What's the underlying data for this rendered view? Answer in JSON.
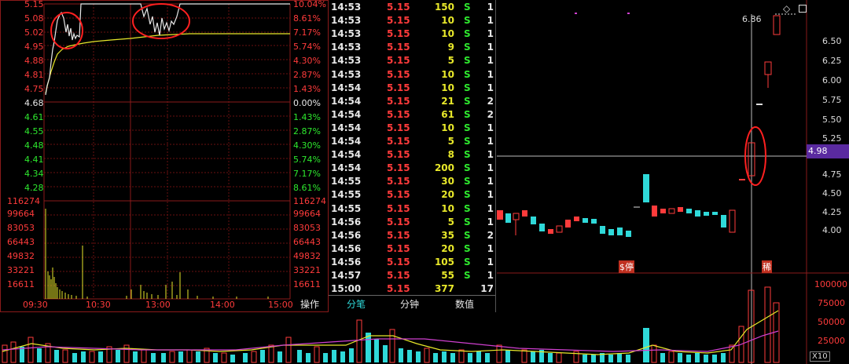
{
  "intraday": {
    "price_labels_left": [
      "5.15",
      "5.08",
      "5.02",
      "4.95",
      "4.88",
      "4.81",
      "4.75",
      "4.68",
      "4.61",
      "4.55",
      "4.48",
      "4.41",
      "4.34",
      "4.28"
    ],
    "pct_labels_right": [
      "10.04%",
      "8.61%",
      "7.17%",
      "5.74%",
      "4.30%",
      "2.87%",
      "1.43%",
      "0.00%",
      "1.43%",
      "2.87%",
      "4.30%",
      "5.74%",
      "7.17%",
      "8.61%"
    ],
    "volume_labels": [
      "116274",
      "99664",
      "83053",
      "66443",
      "49832",
      "33221",
      "16611"
    ],
    "time_labels": [
      "09:30",
      "10:30",
      "13:00",
      "14:00",
      "15:00"
    ]
  },
  "ticks": {
    "rows": [
      {
        "time": "14:53",
        "price": "5.15",
        "vol": "150",
        "side": "S",
        "n": "1"
      },
      {
        "time": "14:53",
        "price": "5.15",
        "vol": "10",
        "side": "S",
        "n": "1"
      },
      {
        "time": "14:53",
        "price": "5.15",
        "vol": "10",
        "side": "S",
        "n": "1"
      },
      {
        "time": "14:53",
        "price": "5.15",
        "vol": "9",
        "side": "S",
        "n": "1"
      },
      {
        "time": "14:53",
        "price": "5.15",
        "vol": "5",
        "side": "S",
        "n": "1"
      },
      {
        "time": "14:53",
        "price": "5.15",
        "vol": "10",
        "side": "S",
        "n": "1"
      },
      {
        "time": "14:54",
        "price": "5.15",
        "vol": "10",
        "side": "S",
        "n": "1"
      },
      {
        "time": "14:54",
        "price": "5.15",
        "vol": "21",
        "side": "S",
        "n": "2"
      },
      {
        "time": "14:54",
        "price": "5.15",
        "vol": "61",
        "side": "S",
        "n": "2"
      },
      {
        "time": "14:54",
        "price": "5.15",
        "vol": "10",
        "side": "S",
        "n": "1"
      },
      {
        "time": "14:54",
        "price": "5.15",
        "vol": "5",
        "side": "S",
        "n": "1"
      },
      {
        "time": "14:54",
        "price": "5.15",
        "vol": "8",
        "side": "S",
        "n": "1"
      },
      {
        "time": "14:54",
        "price": "5.15",
        "vol": "200",
        "side": "S",
        "n": "1"
      },
      {
        "time": "14:55",
        "price": "5.15",
        "vol": "30",
        "side": "S",
        "n": "1"
      },
      {
        "time": "14:55",
        "price": "5.15",
        "vol": "20",
        "side": "S",
        "n": "1"
      },
      {
        "time": "14:55",
        "price": "5.15",
        "vol": "10",
        "side": "S",
        "n": "1"
      },
      {
        "time": "14:56",
        "price": "5.15",
        "vol": "5",
        "side": "S",
        "n": "1"
      },
      {
        "time": "14:56",
        "price": "5.15",
        "vol": "35",
        "side": "S",
        "n": "2"
      },
      {
        "time": "14:56",
        "price": "5.15",
        "vol": "20",
        "side": "S",
        "n": "1"
      },
      {
        "time": "14:56",
        "price": "5.15",
        "vol": "105",
        "side": "S",
        "n": "1"
      },
      {
        "time": "14:57",
        "price": "5.15",
        "vol": "55",
        "side": "S",
        "n": "1"
      },
      {
        "time": "15:00",
        "price": "5.15",
        "vol": "377",
        "side": "",
        "n": "17"
      }
    ]
  },
  "tabs": {
    "ops": "操作",
    "fenbi": "分笔",
    "fenzhong": "分钟",
    "shuzhi": "数值"
  },
  "kline": {
    "price_axis": [
      "6.50",
      "6.25",
      "6.00",
      "5.75",
      "5.50",
      "5.25",
      "4.75",
      "4.50",
      "4.25",
      "4.00"
    ],
    "current_price": "4.98",
    "peak_label": "6.86",
    "volume_axis": [
      "100000",
      "75000",
      "50000",
      "25000"
    ],
    "volume_unit": "X10",
    "zt_marker": "$停",
    "zt_marker2": "稀",
    "colors": {
      "up": "#ff3b3b",
      "down": "#2fd9d9",
      "ma5": "#e8e82a",
      "ma10": "#d040d0",
      "price_tag_bg": "#5a2aa0"
    }
  }
}
